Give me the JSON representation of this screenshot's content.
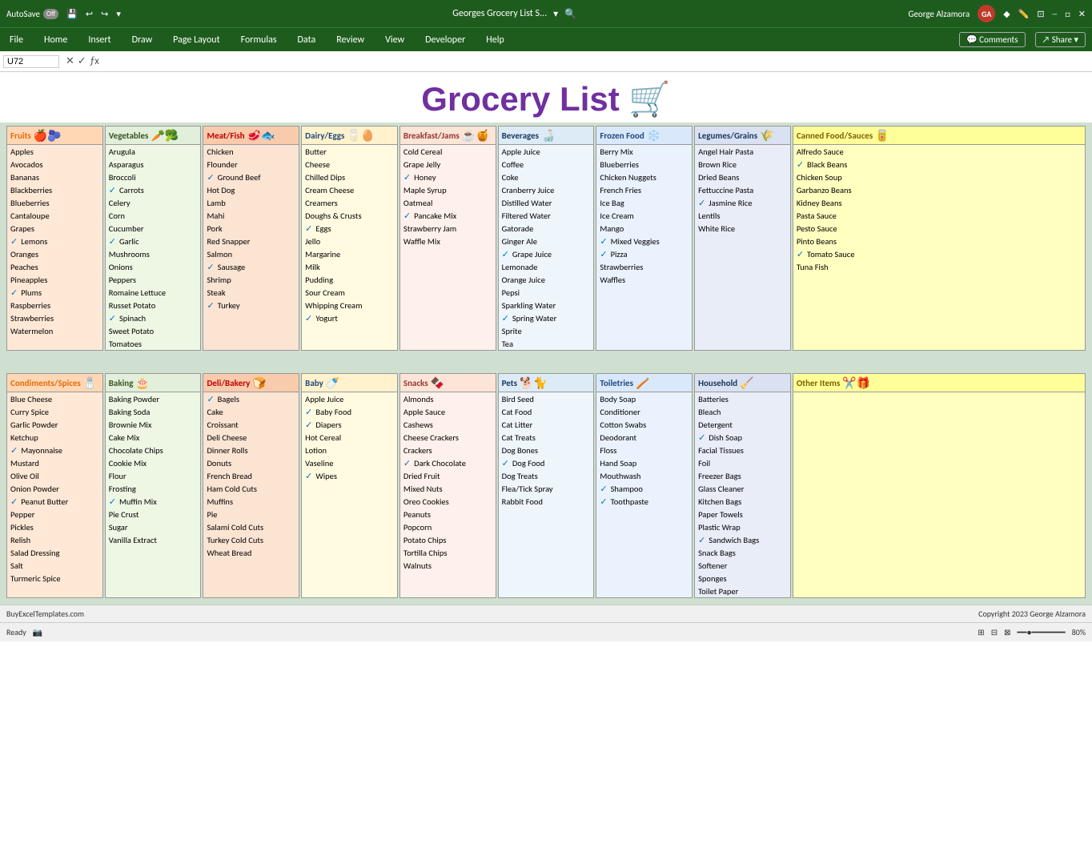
{
  "titlebar": {
    "autosave": "AutoSave",
    "autosave_state": "Off",
    "filename": "Georges Grocery List S...",
    "username": "George Alzamora",
    "initials": "GA"
  },
  "menubar": {
    "items": [
      "File",
      "Home",
      "Insert",
      "Draw",
      "Page Layout",
      "Formulas",
      "Data",
      "Review",
      "View",
      "Developer",
      "Help"
    ],
    "right": [
      "Comments",
      "Share"
    ]
  },
  "formulabar": {
    "cell_ref": "U72",
    "formula": ""
  },
  "title": "Grocery List",
  "categories_row1": {
    "fruits": {
      "label": "Fruits",
      "emoji": "🍎🫐",
      "items": [
        {
          "name": "Apples",
          "checked": false
        },
        {
          "name": "Avocados",
          "checked": false
        },
        {
          "name": "Bananas",
          "checked": false
        },
        {
          "name": "Blackberries",
          "checked": false
        },
        {
          "name": "Blueberries",
          "checked": false
        },
        {
          "name": "Cantaloupe",
          "checked": false
        },
        {
          "name": "Grapes",
          "checked": false
        },
        {
          "name": "Lemons",
          "checked": true
        },
        {
          "name": "Oranges",
          "checked": false
        },
        {
          "name": "Peaches",
          "checked": false
        },
        {
          "name": "Pineapples",
          "checked": false
        },
        {
          "name": "Plums",
          "checked": true
        },
        {
          "name": "Raspberries",
          "checked": false
        },
        {
          "name": "Strawberries",
          "checked": false
        },
        {
          "name": "Watermelon",
          "checked": false
        }
      ]
    },
    "vegetables": {
      "label": "Vegetables",
      "emoji": "🥕🥦",
      "items": [
        {
          "name": "Arugula",
          "checked": false
        },
        {
          "name": "Asparagus",
          "checked": false
        },
        {
          "name": "Broccoli",
          "checked": false
        },
        {
          "name": "Carrots",
          "checked": true
        },
        {
          "name": "Celery",
          "checked": false
        },
        {
          "name": "Corn",
          "checked": false
        },
        {
          "name": "Cucumber",
          "checked": false
        },
        {
          "name": "Garlic",
          "checked": true
        },
        {
          "name": "Mushrooms",
          "checked": false
        },
        {
          "name": "Onions",
          "checked": false
        },
        {
          "name": "Peppers",
          "checked": false
        },
        {
          "name": "Romaine Lettuce",
          "checked": false
        },
        {
          "name": "Russet Potato",
          "checked": false
        },
        {
          "name": "Spinach",
          "checked": true
        },
        {
          "name": "Sweet Potato",
          "checked": false
        },
        {
          "name": "Tomatoes",
          "checked": false
        }
      ]
    },
    "meat": {
      "label": "Meat/Fish",
      "emoji": "🥩🐟",
      "items": [
        {
          "name": "Chicken",
          "checked": false
        },
        {
          "name": "Flounder",
          "checked": false
        },
        {
          "name": "Ground Beef",
          "checked": true
        },
        {
          "name": "Hot Dog",
          "checked": false
        },
        {
          "name": "Lamb",
          "checked": false
        },
        {
          "name": "Mahi",
          "checked": false
        },
        {
          "name": "Pork",
          "checked": false
        },
        {
          "name": "Red Snapper",
          "checked": false
        },
        {
          "name": "Salmon",
          "checked": false
        },
        {
          "name": "Sausage",
          "checked": true
        },
        {
          "name": "Shrimp",
          "checked": false
        },
        {
          "name": "Steak",
          "checked": false
        },
        {
          "name": "Turkey",
          "checked": true
        }
      ]
    },
    "dairy": {
      "label": "Dairy/Eggs",
      "emoji": "🥛🥚",
      "items": [
        {
          "name": "Butter",
          "checked": false
        },
        {
          "name": "Cheese",
          "checked": false
        },
        {
          "name": "Chilled Dips",
          "checked": false
        },
        {
          "name": "Cream Cheese",
          "checked": false
        },
        {
          "name": "Creamers",
          "checked": false
        },
        {
          "name": "Doughs & Crusts",
          "checked": false
        },
        {
          "name": "Eggs",
          "checked": true
        },
        {
          "name": "Jello",
          "checked": false
        },
        {
          "name": "Margarine",
          "checked": false
        },
        {
          "name": "Milk",
          "checked": false
        },
        {
          "name": "Pudding",
          "checked": false
        },
        {
          "name": "Sour Cream",
          "checked": false
        },
        {
          "name": "Whipping Cream",
          "checked": false
        },
        {
          "name": "Yogurt",
          "checked": true
        }
      ]
    },
    "breakfast": {
      "label": "Breakfast/Jams",
      "emoji": "☕🍯",
      "items": [
        {
          "name": "Cold Cereal",
          "checked": false
        },
        {
          "name": "Grape Jelly",
          "checked": false
        },
        {
          "name": "Honey",
          "checked": true
        },
        {
          "name": "Maple Syrup",
          "checked": false
        },
        {
          "name": "Oatmeal",
          "checked": false
        },
        {
          "name": "Pancake Mix",
          "checked": true
        },
        {
          "name": "Strawberry Jam",
          "checked": false
        },
        {
          "name": "Waffle Mix",
          "checked": false
        }
      ]
    },
    "beverages": {
      "label": "Beverages",
      "emoji": "🍶",
      "items": [
        {
          "name": "Apple Juice",
          "checked": false
        },
        {
          "name": "Coffee",
          "checked": false
        },
        {
          "name": "Coke",
          "checked": false
        },
        {
          "name": "Cranberry Juice",
          "checked": false
        },
        {
          "name": "Distilled Water",
          "checked": false
        },
        {
          "name": "Filtered Water",
          "checked": false
        },
        {
          "name": "Gatorade",
          "checked": false
        },
        {
          "name": "Ginger Ale",
          "checked": false
        },
        {
          "name": "Grape Juice",
          "checked": true
        },
        {
          "name": "Lemonade",
          "checked": false
        },
        {
          "name": "Orange Juice",
          "checked": false
        },
        {
          "name": "Pepsi",
          "checked": false
        },
        {
          "name": "Sparkling Water",
          "checked": false
        },
        {
          "name": "Spring Water",
          "checked": true
        },
        {
          "name": "Sprite",
          "checked": false
        },
        {
          "name": "Tea",
          "checked": false
        }
      ]
    },
    "frozen": {
      "label": "Frozen Food",
      "emoji": "❄️",
      "items": [
        {
          "name": "Berry Mix",
          "checked": false
        },
        {
          "name": "Blueberries",
          "checked": false
        },
        {
          "name": "Chicken Nuggets",
          "checked": false
        },
        {
          "name": "French Fries",
          "checked": false
        },
        {
          "name": "Ice Bag",
          "checked": false
        },
        {
          "name": "Ice Cream",
          "checked": false
        },
        {
          "name": "Mango",
          "checked": false
        },
        {
          "name": "Mixed Veggies",
          "checked": true
        },
        {
          "name": "Pizza",
          "checked": true
        },
        {
          "name": "Strawberries",
          "checked": false
        },
        {
          "name": "Waffles",
          "checked": false
        }
      ]
    },
    "legumes": {
      "label": "Legumes/Grains",
      "emoji": "🌾",
      "items": [
        {
          "name": "Angel Hair Pasta",
          "checked": false
        },
        {
          "name": "Brown Rice",
          "checked": false
        },
        {
          "name": "Dried Beans",
          "checked": false
        },
        {
          "name": "Fettuccine Pasta",
          "checked": false
        },
        {
          "name": "Jasmine Rice",
          "checked": true
        },
        {
          "name": "Lentils",
          "checked": false
        },
        {
          "name": "White Rice",
          "checked": false
        }
      ]
    },
    "canned": {
      "label": "Canned Food/Sauces",
      "emoji": "🥫",
      "items": [
        {
          "name": "Alfredo Sauce",
          "checked": false
        },
        {
          "name": "Black Beans",
          "checked": true
        },
        {
          "name": "Chicken Soup",
          "checked": false
        },
        {
          "name": "Garbanzo Beans",
          "checked": false
        },
        {
          "name": "Kidney Beans",
          "checked": false
        },
        {
          "name": "Pasta Sauce",
          "checked": false
        },
        {
          "name": "Pesto Sauce",
          "checked": false
        },
        {
          "name": "Pinto Beans",
          "checked": false
        },
        {
          "name": "Tomato Sauce",
          "checked": true
        },
        {
          "name": "Tuna Fish",
          "checked": false
        }
      ]
    }
  },
  "categories_row2": {
    "condiments": {
      "label": "Condiments/Spices",
      "emoji": "🧂",
      "items": [
        {
          "name": "Blue Cheese",
          "checked": false
        },
        {
          "name": "Curry Spice",
          "checked": false
        },
        {
          "name": "Garlic Powder",
          "checked": false
        },
        {
          "name": "Ketchup",
          "checked": false
        },
        {
          "name": "Mayonnaise",
          "checked": true
        },
        {
          "name": "Mustard",
          "checked": false
        },
        {
          "name": "Olive Oil",
          "checked": false
        },
        {
          "name": "Onion Powder",
          "checked": false
        },
        {
          "name": "Peanut Butter",
          "checked": true
        },
        {
          "name": "Pepper",
          "checked": false
        },
        {
          "name": "Pickles",
          "checked": false
        },
        {
          "name": "Relish",
          "checked": false
        },
        {
          "name": "Salad Dressing",
          "checked": false
        },
        {
          "name": "Salt",
          "checked": false
        },
        {
          "name": "Turmeric Spice",
          "checked": false
        }
      ]
    },
    "baking": {
      "label": "Baking",
      "emoji": "🎂",
      "items": [
        {
          "name": "Baking Powder",
          "checked": false
        },
        {
          "name": "Baking Soda",
          "checked": false
        },
        {
          "name": "Brownie Mix",
          "checked": false
        },
        {
          "name": "Cake Mix",
          "checked": false
        },
        {
          "name": "Chocolate Chips",
          "checked": false
        },
        {
          "name": "Cookie Mix",
          "checked": false
        },
        {
          "name": "Flour",
          "checked": false
        },
        {
          "name": "Frosting",
          "checked": false
        },
        {
          "name": "Muffin Mix",
          "checked": true
        },
        {
          "name": "Pie Crust",
          "checked": false
        },
        {
          "name": "Sugar",
          "checked": false
        },
        {
          "name": "Vanilla Extract",
          "checked": false
        }
      ]
    },
    "deli": {
      "label": "Deli/Bakery",
      "emoji": "🍞",
      "items": [
        {
          "name": "Bagels",
          "checked": true
        },
        {
          "name": "Cake",
          "checked": false
        },
        {
          "name": "Croissant",
          "checked": false
        },
        {
          "name": "Deli Cheese",
          "checked": false
        },
        {
          "name": "Dinner Rolls",
          "checked": false
        },
        {
          "name": "Donuts",
          "checked": false
        },
        {
          "name": "French Bread",
          "checked": false
        },
        {
          "name": "Ham Cold Cuts",
          "checked": false
        },
        {
          "name": "Muffins",
          "checked": false
        },
        {
          "name": "Pie",
          "checked": false
        },
        {
          "name": "Salami Cold Cuts",
          "checked": false
        },
        {
          "name": "Turkey Cold Cuts",
          "checked": false
        },
        {
          "name": "Wheat Bread",
          "checked": false
        }
      ]
    },
    "baby": {
      "label": "Baby",
      "emoji": "🍼",
      "items": [
        {
          "name": "Apple Juice",
          "checked": false
        },
        {
          "name": "Baby Food",
          "checked": true
        },
        {
          "name": "Diapers",
          "checked": true
        },
        {
          "name": "Hot Cereal",
          "checked": false
        },
        {
          "name": "Lotion",
          "checked": false
        },
        {
          "name": "Vaseline",
          "checked": false
        },
        {
          "name": "Wipes",
          "checked": true
        }
      ]
    },
    "snacks": {
      "label": "Snacks",
      "emoji": "🍫",
      "items": [
        {
          "name": "Almonds",
          "checked": false
        },
        {
          "name": "Apple Sauce",
          "checked": false
        },
        {
          "name": "Cashews",
          "checked": false
        },
        {
          "name": "Cheese Crackers",
          "checked": false
        },
        {
          "name": "Crackers",
          "checked": false
        },
        {
          "name": "Dark Chocolate",
          "checked": true
        },
        {
          "name": "Dried Fruit",
          "checked": false
        },
        {
          "name": "Mixed Nuts",
          "checked": false
        },
        {
          "name": "Oreo Cookies",
          "checked": false
        },
        {
          "name": "Peanuts",
          "checked": false
        },
        {
          "name": "Popcorn",
          "checked": false
        },
        {
          "name": "Potato Chips",
          "checked": false
        },
        {
          "name": "Tortilla Chips",
          "checked": false
        },
        {
          "name": "Walnuts",
          "checked": false
        }
      ]
    },
    "pets": {
      "label": "Pets",
      "emoji": "🐕🐈",
      "items": [
        {
          "name": "Bird Seed",
          "checked": false
        },
        {
          "name": "Cat Food",
          "checked": false
        },
        {
          "name": "Cat Litter",
          "checked": false
        },
        {
          "name": "Cat Treats",
          "checked": false
        },
        {
          "name": "Dog Bones",
          "checked": false
        },
        {
          "name": "Dog Food",
          "checked": true
        },
        {
          "name": "Dog Treats",
          "checked": false
        },
        {
          "name": "Flea/Tick Spray",
          "checked": false
        },
        {
          "name": "Rabbit Food",
          "checked": false
        }
      ]
    },
    "toiletries": {
      "label": "Toiletries",
      "emoji": "🪥",
      "items": [
        {
          "name": "Body Soap",
          "checked": false
        },
        {
          "name": "Conditioner",
          "checked": false
        },
        {
          "name": "Cotton Swabs",
          "checked": false
        },
        {
          "name": "Deodorant",
          "checked": false
        },
        {
          "name": "Floss",
          "checked": false
        },
        {
          "name": "Hand Soap",
          "checked": false
        },
        {
          "name": "Mouthwash",
          "checked": false
        },
        {
          "name": "Shampoo",
          "checked": true
        },
        {
          "name": "Toothpaste",
          "checked": true
        }
      ]
    },
    "household": {
      "label": "Household",
      "emoji": "🧹",
      "items": [
        {
          "name": "Batteries",
          "checked": false
        },
        {
          "name": "Bleach",
          "checked": false
        },
        {
          "name": "Detergent",
          "checked": false
        },
        {
          "name": "Dish Soap",
          "checked": true
        },
        {
          "name": "Facial Tissues",
          "checked": false
        },
        {
          "name": "Foil",
          "checked": false
        },
        {
          "name": "Freezer Bags",
          "checked": false
        },
        {
          "name": "Glass Cleaner",
          "checked": false
        },
        {
          "name": "Kitchen Bags",
          "checked": false
        },
        {
          "name": "Paper Towels",
          "checked": false
        },
        {
          "name": "Plastic Wrap",
          "checked": false
        },
        {
          "name": "Sandwich Bags",
          "checked": true
        },
        {
          "name": "Snack Bags",
          "checked": false
        },
        {
          "name": "Softener",
          "checked": false
        },
        {
          "name": "Sponges",
          "checked": false
        },
        {
          "name": "Toilet Paper",
          "checked": false
        }
      ]
    },
    "other": {
      "label": "Other Items",
      "emoji": "✂️🎁",
      "items": []
    }
  },
  "footer": {
    "left": "BuyExcelTemplates.com",
    "right": "Copyright 2023 George Alzamora"
  },
  "statusbar": {
    "ready": "Ready",
    "zoom": "80%"
  }
}
